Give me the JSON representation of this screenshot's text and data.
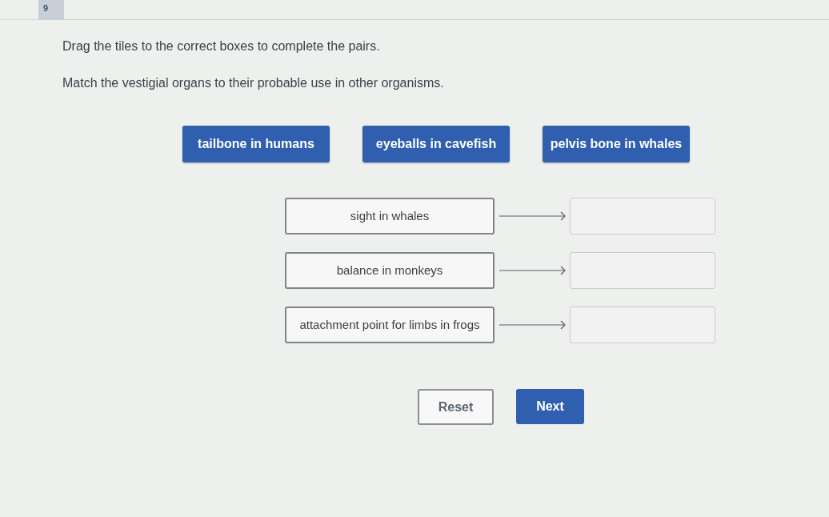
{
  "question_number": "9",
  "instructions": [
    "Drag the tiles to the correct boxes to complete the pairs.",
    "Match the vestigial organs to their probable use in other organisms."
  ],
  "tiles": [
    {
      "label": "tailbone in humans"
    },
    {
      "label": "eyeballs in cavefish"
    },
    {
      "label": "pelvis bone in whales"
    }
  ],
  "pairs": [
    {
      "prompt": "sight in whales"
    },
    {
      "prompt": "balance in monkeys"
    },
    {
      "prompt": "attachment point for limbs in frogs"
    }
  ],
  "buttons": [
    {
      "label": "Reset",
      "kind": "secondary"
    },
    {
      "label": "Next",
      "kind": "primary"
    }
  ]
}
